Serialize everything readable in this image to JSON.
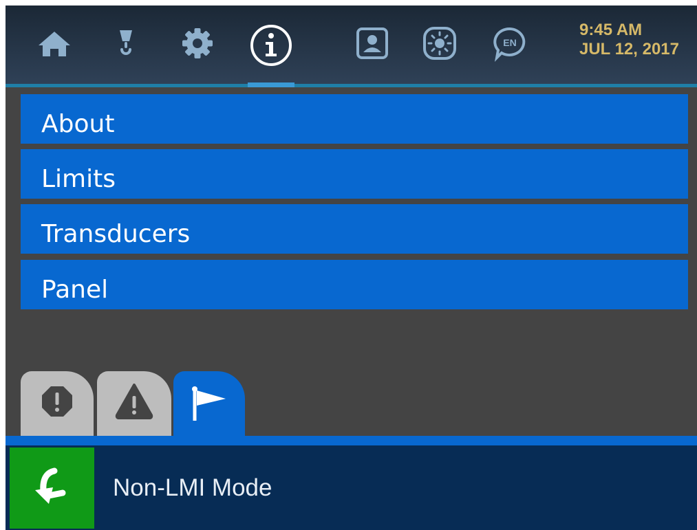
{
  "header": {
    "icons": [
      "home-icon",
      "crane-hook-icon",
      "gear-icon",
      "info-icon",
      "operator-icon",
      "brightness-icon",
      "language-icon"
    ],
    "language_code": "EN",
    "time": "9:45 AM",
    "date": "JUL 12, 2017"
  },
  "menu": {
    "items": [
      {
        "label": "About"
      },
      {
        "label": "Limits"
      },
      {
        "label": "Transducers"
      },
      {
        "label": "Panel"
      }
    ]
  },
  "alert_tabs": [
    "error-icon",
    "warning-icon",
    "flag-icon"
  ],
  "status": {
    "mode_label": "Non-LMI Mode"
  },
  "colors": {
    "menu_blue": "#0868d0",
    "header_dark": "#1b2836",
    "mode_green": "#109a17",
    "clock_gold": "#d6b968",
    "status_navy": "#072c55"
  }
}
